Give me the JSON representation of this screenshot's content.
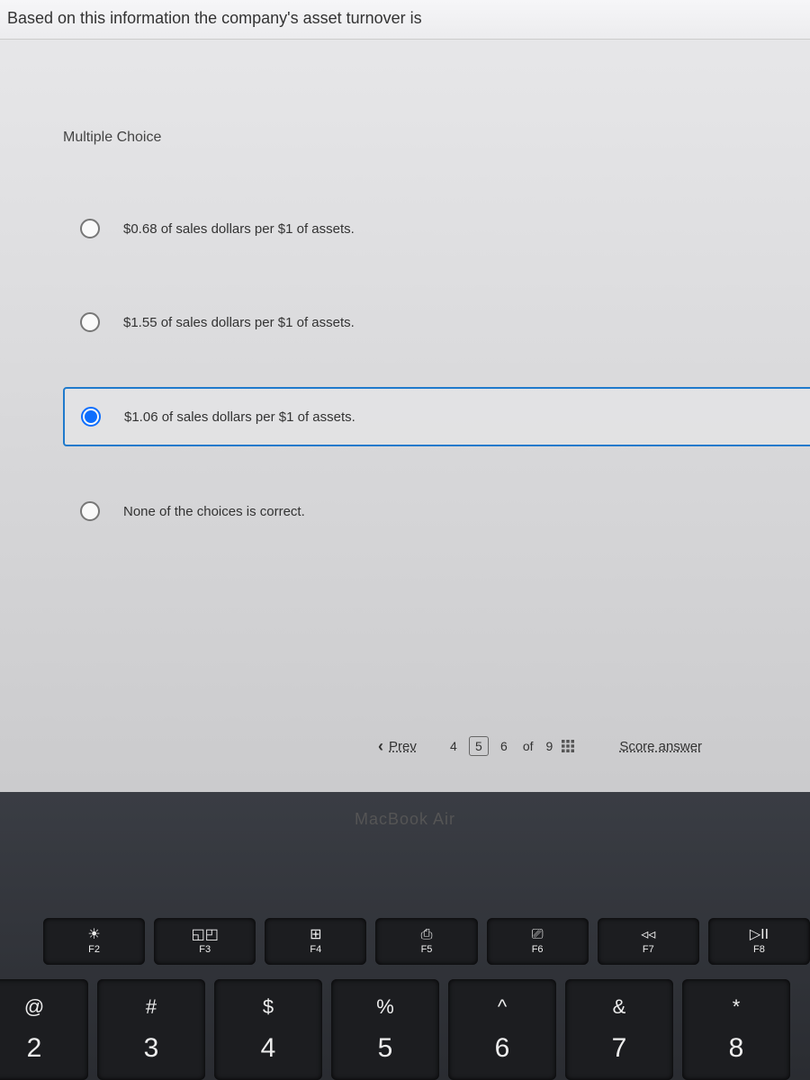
{
  "question": "Based on this information the company's asset turnover is",
  "mc_label": "Multiple Choice",
  "options": [
    {
      "text": "$0.68 of sales dollars per $1 of assets.",
      "selected": false
    },
    {
      "text": "$1.55 of sales dollars per $1 of assets.",
      "selected": false
    },
    {
      "text": "$1.06 of sales dollars per $1 of assets.",
      "selected": true
    },
    {
      "text": "None of the choices is correct.",
      "selected": false
    }
  ],
  "nav": {
    "prev_label": "Prev",
    "pages": [
      "4",
      "5",
      "6"
    ],
    "current_index": 1,
    "of_label": "of",
    "total": "9",
    "score_label": "Score answer"
  },
  "laptop": {
    "brand": "MacBook Air",
    "fn_keys": [
      {
        "icon": "☀",
        "label": "F2"
      },
      {
        "icon": "◱◰",
        "label": "F3"
      },
      {
        "icon": "⊞",
        "label": "F4"
      },
      {
        "icon": "⎙",
        "label": "F5"
      },
      {
        "icon": "⎚",
        "label": "F6"
      },
      {
        "icon": "◃◃",
        "label": "F7"
      },
      {
        "icon": "▷II",
        "label": "F8"
      }
    ],
    "num_keys": [
      {
        "sym": "@",
        "num": "2"
      },
      {
        "sym": "#",
        "num": "3"
      },
      {
        "sym": "$",
        "num": "4"
      },
      {
        "sym": "%",
        "num": "5"
      },
      {
        "sym": "^",
        "num": "6"
      },
      {
        "sym": "&",
        "num": "7"
      },
      {
        "sym": "*",
        "num": "8"
      }
    ]
  }
}
